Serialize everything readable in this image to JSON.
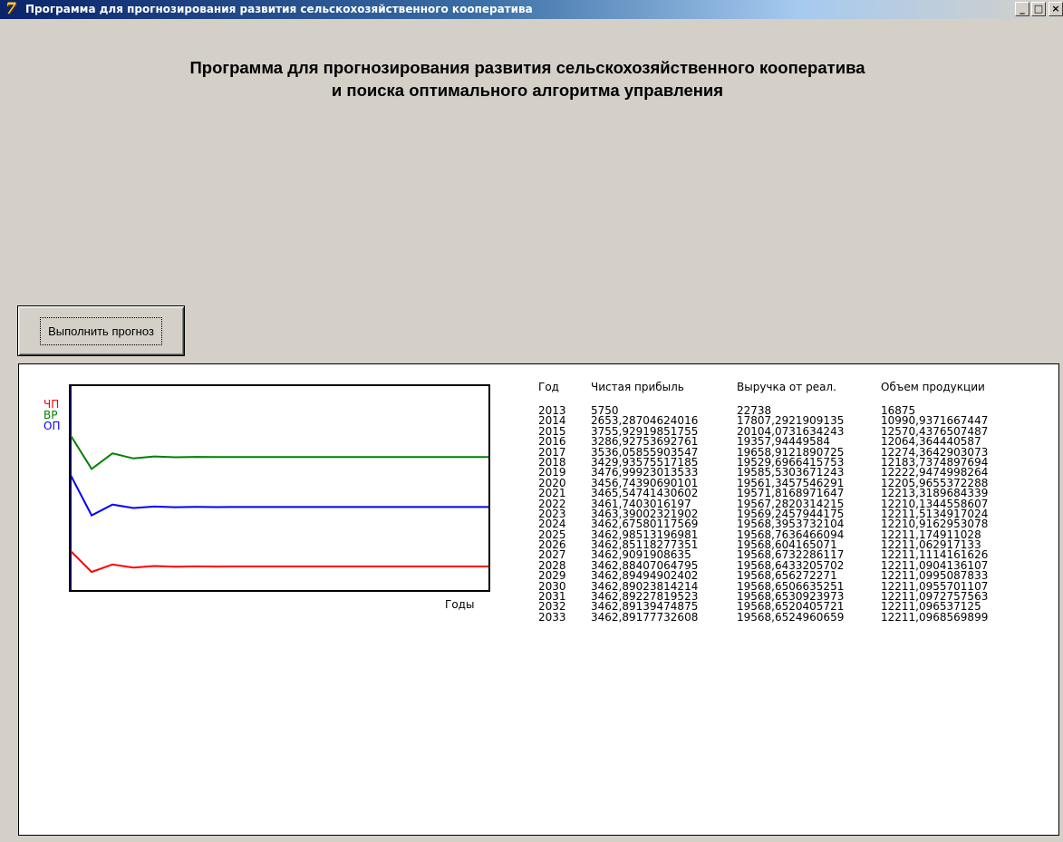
{
  "window": {
    "title": "Программа для прогнозирования развития сельскохозяйственного кооператива",
    "app_icon_glyph": "7",
    "controls": {
      "minimize": "_",
      "maximize": "□",
      "close": "×"
    }
  },
  "heading": {
    "line1": "Программа для прогнозирования развития сельскохозяйственного кооператива",
    "line2": "и поиска оптимального алгоритма управления"
  },
  "run_button": {
    "label": "Выполнить прогноз"
  },
  "chart": {
    "legend": [
      {
        "label": "ЧП",
        "color": "#ff0000"
      },
      {
        "label": "ВР",
        "color": "#008000"
      },
      {
        "label": "ОП",
        "color": "#0000ff"
      }
    ],
    "xlabel": "Годы"
  },
  "table": {
    "headers": [
      "Год",
      "Чистая прибыль",
      "Выручка от реал.",
      "Объем продукции"
    ],
    "rows": [
      [
        "2013",
        "5750",
        "22738",
        "16875"
      ],
      [
        "2014",
        "2653,28704624016",
        "17807,2921909135",
        "10990,9371667447"
      ],
      [
        "2015",
        "3755,92919851755",
        "20104,0731634243",
        "12570,4376507487"
      ],
      [
        "2016",
        "3286,92753692761",
        "19357,94449584",
        "12064,364440587"
      ],
      [
        "2017",
        "3536,05855903547",
        "19658,9121890725",
        "12274,3642903073"
      ],
      [
        "2018",
        "3429,93575517185",
        "19529,6966415753",
        "12183,7374897694"
      ],
      [
        "2019",
        "3476,99923013533",
        "19585,5303671243",
        "12222,9474998264"
      ],
      [
        "2020",
        "3456,74390690101",
        "19561,3457546291",
        "12205,9655372288"
      ],
      [
        "2021",
        "3465,54741430602",
        "19571,8168971647",
        "12213,3189684339"
      ],
      [
        "2022",
        "3461,7403016197",
        "19567,2820314215",
        "12210,1344558607"
      ],
      [
        "2023",
        "3463,39002321902",
        "19569,2457944175",
        "12211,5134917024"
      ],
      [
        "2024",
        "3462,67580117569",
        "19568,3953732104",
        "12210,9162953078"
      ],
      [
        "2025",
        "3462,98513196981",
        "19568,7636466094",
        "12211,174911028"
      ],
      [
        "2026",
        "3462,85118277351",
        "19568,604165071",
        "12211,062917133"
      ],
      [
        "2027",
        "3462,9091908635",
        "19568,6732286117",
        "12211,1114161626"
      ],
      [
        "2028",
        "3462,88407064795",
        "19568,6433205702",
        "12211,0904136107"
      ],
      [
        "2029",
        "3462,89494902402",
        "19568,656272271",
        "12211,0995087833"
      ],
      [
        "2030",
        "3462,89023814214",
        "19568,6506635251",
        "12211,0955701107"
      ],
      [
        "2031",
        "3462,89227819523",
        "19568,6530923973",
        "12211,0972757563"
      ],
      [
        "2032",
        "3462,89139474875",
        "19568,6520405721",
        "12211,096537125"
      ],
      [
        "2033",
        "3462,89177732608",
        "19568,6524960659",
        "12211,0968569899"
      ]
    ]
  },
  "chart_data": {
    "type": "line",
    "x": [
      2013,
      2014,
      2015,
      2016,
      2017,
      2018,
      2019,
      2020,
      2021,
      2022,
      2023,
      2024,
      2025,
      2026,
      2027,
      2028,
      2029,
      2030,
      2031,
      2032,
      2033
    ],
    "series": [
      {
        "name": "ЧП",
        "color": "#ff0000",
        "values": [
          5750,
          2653.29,
          3755.93,
          3286.93,
          3536.06,
          3429.94,
          3477.0,
          3456.74,
          3465.55,
          3461.74,
          3463.39,
          3462.68,
          3462.99,
          3462.85,
          3462.91,
          3462.88,
          3462.89,
          3462.89,
          3462.89,
          3462.89,
          3462.89
        ]
      },
      {
        "name": "ВР",
        "color": "#008000",
        "values": [
          22738,
          17807.29,
          20104.07,
          19357.94,
          19658.91,
          19529.7,
          19585.53,
          19561.35,
          19571.82,
          19567.28,
          19569.25,
          19568.4,
          19568.76,
          19568.6,
          19568.67,
          19568.64,
          19568.66,
          19568.65,
          19568.65,
          19568.65,
          19568.65
        ]
      },
      {
        "name": "ОП",
        "color": "#0000ff",
        "values": [
          16875,
          10990.94,
          12570.44,
          12064.36,
          12274.36,
          12183.74,
          12222.95,
          12205.97,
          12213.32,
          12210.13,
          12211.51,
          12210.92,
          12211.17,
          12211.06,
          12211.11,
          12211.09,
          12211.1,
          12211.1,
          12211.1,
          12211.1,
          12211.1
        ]
      }
    ],
    "title": "",
    "xlabel": "Годы",
    "ylabel": "",
    "ylim": [
      0,
      30000
    ],
    "grid": false,
    "legend": "left"
  }
}
